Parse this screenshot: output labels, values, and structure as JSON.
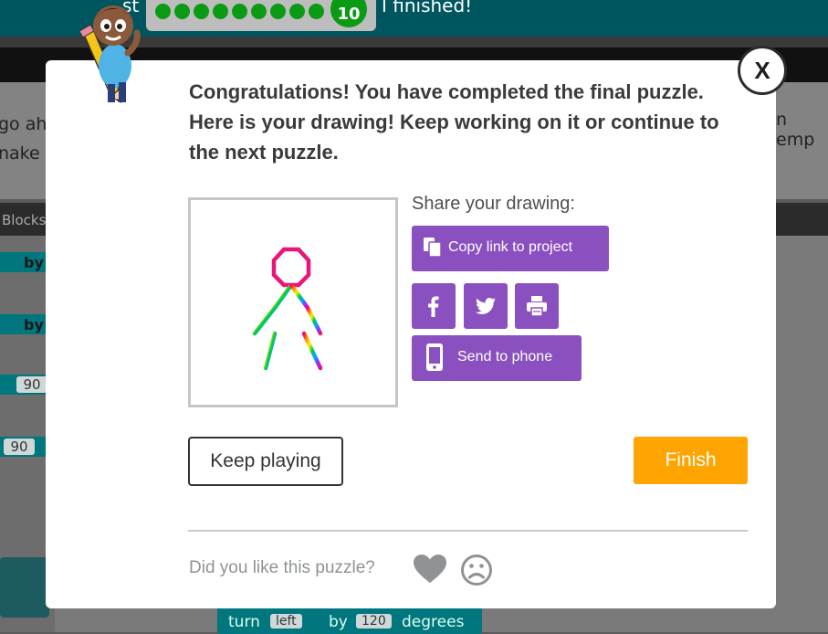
{
  "background": {
    "header_left_text": "st",
    "level_number": "10",
    "header_right_text": "I finished!",
    "instructions_left_line1": "go ah",
    "instructions_left_line2": "nake c",
    "instructions_right": "n emp",
    "toolbox_header": "Blocks",
    "block_by_1": "by",
    "block_by_2": "by",
    "block_num_1": "90",
    "block_num_2": "90",
    "bottom_block": {
      "turn": "turn",
      "direction": "left",
      "by": "by",
      "value": "120",
      "unit": "degrees"
    }
  },
  "dialog": {
    "close_label": "X",
    "message": "Congratulations! You have completed the final puzzle. Here is your drawing! Keep working on it or continue to the next puzzle.",
    "share_label": "Share your drawing:",
    "copy_link_label": "Copy link to project",
    "send_to_phone_label": "Send to phone",
    "keep_playing_label": "Keep playing",
    "finish_label": "Finish",
    "feedback_question": "Did you like this puzzle?",
    "icons": [
      "copy-icon",
      "facebook-icon",
      "twitter-icon",
      "print-icon",
      "phone-icon",
      "heart-icon",
      "frown-icon"
    ]
  },
  "colors": {
    "purple_button": "#8b50bf",
    "finish_orange": "#ffa400",
    "header_teal": "#00565f"
  }
}
